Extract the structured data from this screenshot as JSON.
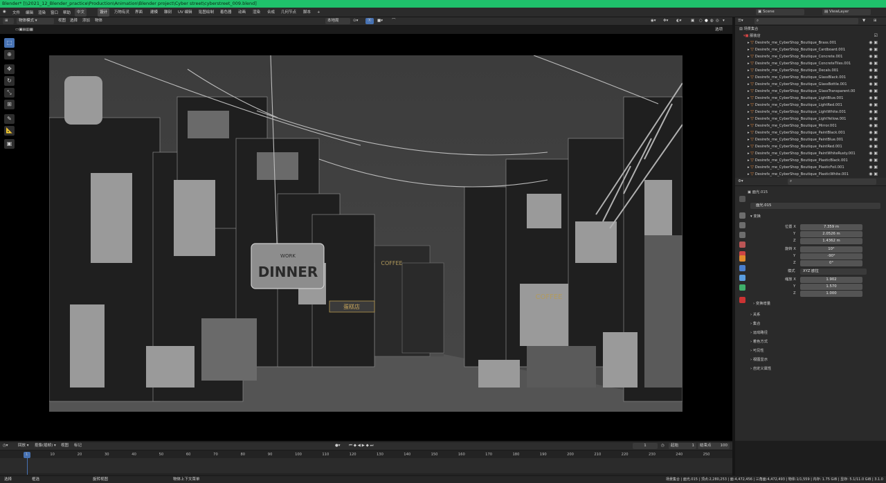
{
  "window_title": "Blender* [\\\\2021_12_Blender_practice\\Production\\Animation\\Blender project\\Cyber street\\cyberstreet_009.blend]",
  "menu": [
    "文件",
    "编辑",
    "渲染",
    "窗口",
    "帮助"
  ],
  "language_button": "中文",
  "workspace_tabs": [
    "设计",
    "万物有灵",
    "界面",
    "建模",
    "雕刻",
    "UV 编辑",
    "贴图绘制",
    "着色器",
    "动画",
    "渲染",
    "合成",
    "几何节点",
    "脚本"
  ],
  "active_tab": "设计",
  "scene": {
    "label": "Scene",
    "view_layer": "ViewLayer"
  },
  "viewport_header": {
    "mode": "物体模式",
    "menus": [
      "视图",
      "选择",
      "添加",
      "物体"
    ],
    "transform": "本地局",
    "options": "选项"
  },
  "outliner": {
    "root": "场景集合",
    "collection": "服装店",
    "items": [
      "Desirefx_me_CyberShop_Boutique_Brass.001",
      "Desirefx_me_CyberShop_Boutique_Cardboard.001",
      "Desirefx_me_CyberShop_Boutique_Concrete.001",
      "Desirefx_me_CyberShop_Boutique_ConcreteTiles.001",
      "Desirefx_me_CyberShop_Boutique_Decals.001",
      "Desirefx_me_CyberShop_Boutique_GlassBlack.001",
      "Desirefx_me_CyberShop_Boutique_GlassBottle.001",
      "Desirefx_me_CyberShop_Boutique_GlassTransparent.00",
      "Desirefx_me_CyberShop_Boutique_LightBlue.001",
      "Desirefx_me_CyberShop_Boutique_LightRed.001",
      "Desirefx_me_CyberShop_Boutique_LightWhite.001",
      "Desirefx_me_CyberShop_Boutique_LightYellow.001",
      "Desirefx_me_CyberShop_Boutique_Mirror.001",
      "Desirefx_me_CyberShop_Boutique_PaintBlack.001",
      "Desirefx_me_CyberShop_Boutique_PaintBlue.001",
      "Desirefx_me_CyberShop_Boutique_PaintRed.001",
      "Desirefx_me_CyberShop_Boutique_PaintWhiteRusty.001",
      "Desirefx_me_CyberShop_Boutique_PlasticBlack.001",
      "Desirefx_me_CyberShop_Boutique_PlasticFoil.001",
      "Desirefx_me_CyberShop_Boutique_PlasticWhite.001"
    ]
  },
  "properties": {
    "object_name": "面光.015",
    "object_field": "面光.015",
    "transform_title": "变换",
    "location_label": "位置 X",
    "location": [
      "7.359 m",
      "2.0526 m",
      "1.4362 m"
    ],
    "rotation_label": "旋转 X",
    "rotation": [
      "10°",
      "-90°",
      "0°"
    ],
    "mode_label": "模式",
    "mode_value": "XYZ 欧拉",
    "scale_label": "缩放 X",
    "scale": [
      "1.902",
      "1.570",
      "1.000"
    ],
    "axis_y": "Y",
    "axis_z": "Z",
    "delta": "变换增量",
    "panels": [
      "关系",
      "集合",
      "运动路径",
      "着色方式",
      "可见性",
      "视图显示",
      "自定义属性"
    ]
  },
  "viewport": {
    "sign_main": "DINNER",
    "sign_small": "WORK",
    "sign_cn": "蛋糕店",
    "sign_coffee": "COFFEE"
  },
  "timeline": {
    "menus": [
      "回放",
      "抠像(插帧)",
      "视图",
      "标记"
    ],
    "current_frame": "1",
    "start_label": "起始",
    "start": "1",
    "end_label": "结束点",
    "end": "100",
    "ticks": [
      "1",
      "10",
      "20",
      "30",
      "40",
      "50",
      "60",
      "70",
      "80",
      "90",
      "100",
      "110",
      "120",
      "130",
      "140",
      "150",
      "160",
      "170",
      "180",
      "190",
      "200",
      "210",
      "220",
      "230",
      "240",
      "250"
    ]
  },
  "statusbar": {
    "left": [
      "选择",
      "框选",
      "旋转视图",
      "物体上下文菜单"
    ],
    "right": "场景集合 | 面光.015 | 顶点:2,280,253 | 面:4,472,456 | 三角面:4,472,493 | 物体:1/1,559 | 内存: 1.75 GiB | 显存: 5.1/11.0 GiB | 3.1.0"
  },
  "colors": {
    "accent": "#4772b3",
    "titlebar": "#1fc16b",
    "frame_marker": "#4772b3"
  }
}
